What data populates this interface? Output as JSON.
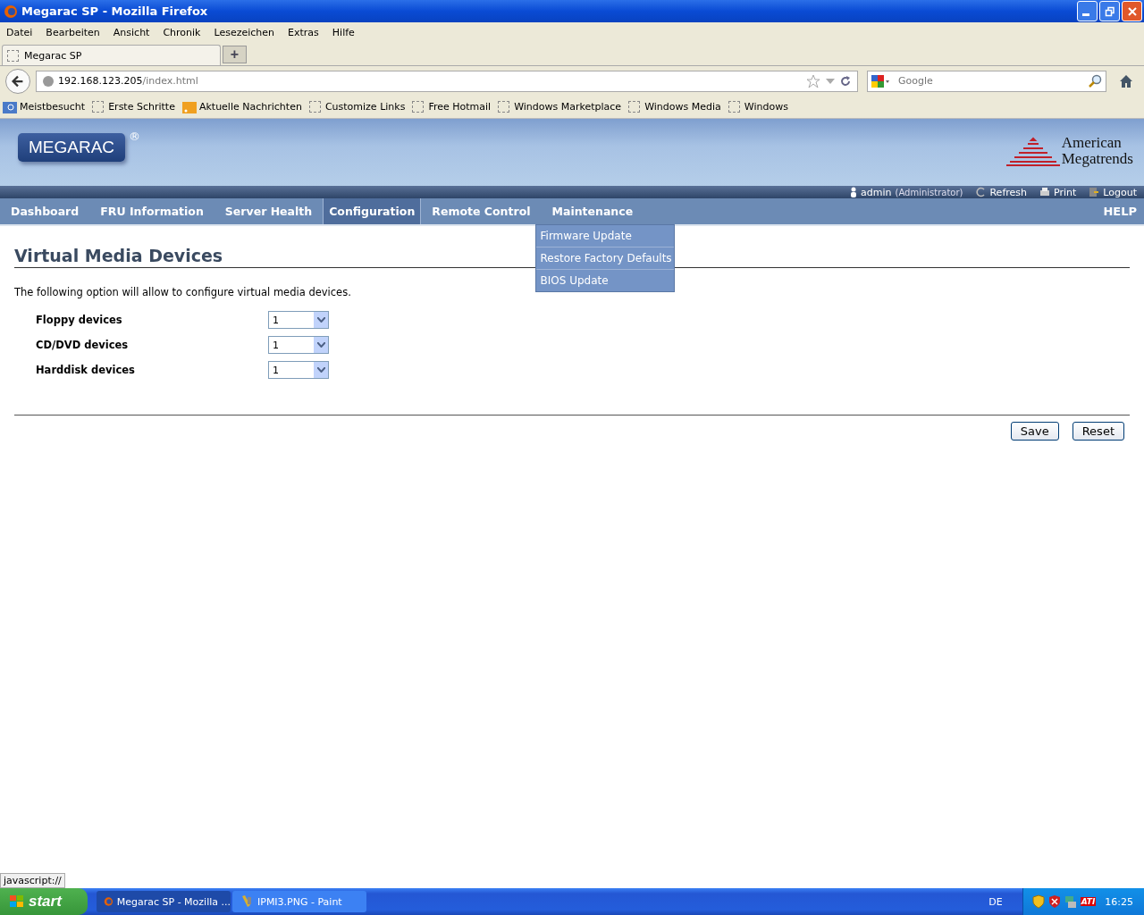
{
  "window": {
    "title": "Megarac SP - Mozilla Firefox"
  },
  "menu_bar": [
    "Datei",
    "Bearbeiten",
    "Ansicht",
    "Chronik",
    "Lesezeichen",
    "Extras",
    "Hilfe"
  ],
  "tabs": [
    {
      "label": "Megarac SP",
      "selected": true
    }
  ],
  "new_tab": "+",
  "address": {
    "host": "192.168.123.205",
    "path": "/index.html"
  },
  "search": {
    "placeholder": "Google"
  },
  "bookmarks": [
    {
      "label": "Meistbesucht",
      "kind": "folder"
    },
    {
      "label": "Erste Schritte",
      "kind": "page"
    },
    {
      "label": "Aktuelle Nachrichten",
      "kind": "feed"
    },
    {
      "label": "Customize Links",
      "kind": "page"
    },
    {
      "label": "Free Hotmail",
      "kind": "page"
    },
    {
      "label": "Windows Marketplace",
      "kind": "page"
    },
    {
      "label": "Windows Media",
      "kind": "page"
    },
    {
      "label": "Windows",
      "kind": "page"
    }
  ],
  "app": {
    "logo": "MEGARAC",
    "registered": "®",
    "vendor": [
      "American",
      "Megatrends"
    ],
    "user": "admin",
    "role": "(Administrator)",
    "actions": [
      {
        "label": "Refresh",
        "kind": "refresh"
      },
      {
        "label": "Print",
        "kind": "print"
      },
      {
        "label": "Logout",
        "kind": "logout"
      }
    ],
    "nav": [
      {
        "label": "Dashboard",
        "selected": false
      },
      {
        "label": "FRU Information",
        "selected": false
      },
      {
        "label": "Server Health",
        "selected": false
      },
      {
        "label": "Configuration",
        "selected": true
      },
      {
        "label": "Remote Control",
        "selected": false
      },
      {
        "label": "Maintenance",
        "selected": false,
        "expanded": true,
        "menu": [
          "Firmware Update",
          "Restore Factory Defaults",
          "BIOS Update"
        ]
      }
    ],
    "help": "HELP",
    "heading": "Virtual Media Devices",
    "description": "The following option will allow to configure virtual media devices.",
    "fields": [
      {
        "label": "Floppy devices",
        "value": "1"
      },
      {
        "label": "CD/DVD devices",
        "value": "1"
      },
      {
        "label": "Harddisk devices",
        "value": "1"
      }
    ],
    "buttons": [
      "Save",
      "Reset"
    ]
  },
  "status": "javascript://",
  "taskbar": {
    "start": "start",
    "tasks": [
      {
        "label": "Megarac SP - Mozilla ...",
        "kind": "firefox",
        "selected": true
      },
      {
        "label": "IPMI3.PNG - Paint",
        "kind": "paint",
        "selected": false
      }
    ],
    "language": "DE",
    "tray_label": "ATI",
    "clock": "16:25"
  }
}
